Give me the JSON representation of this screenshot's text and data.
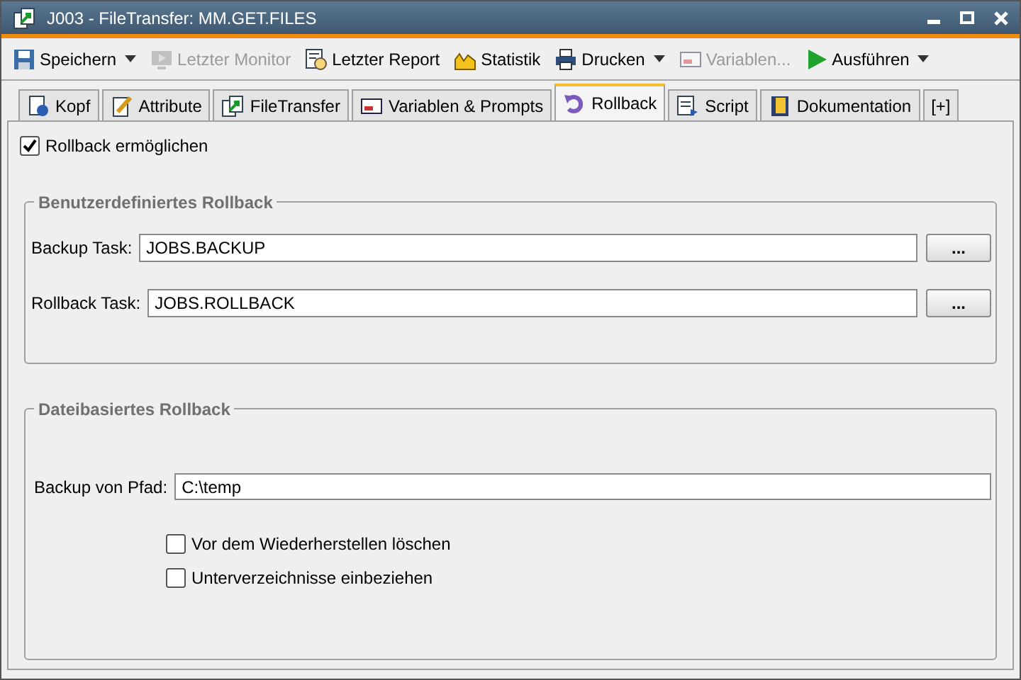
{
  "window": {
    "title": "J003 - FileTransfer: MM.GET.FILES"
  },
  "toolbar": [
    {
      "label": "Speichern",
      "disabled": false,
      "menu": true
    },
    {
      "label": "Letzter Monitor",
      "disabled": true,
      "menu": false
    },
    {
      "label": "Letzter Report",
      "disabled": false,
      "menu": false
    },
    {
      "label": "Statistik",
      "disabled": false,
      "menu": false
    },
    {
      "label": "Drucken",
      "disabled": false,
      "menu": true
    },
    {
      "label": "Variablen...",
      "disabled": true,
      "menu": false
    },
    {
      "label": "Ausführen",
      "disabled": false,
      "menu": true
    }
  ],
  "tabs": [
    {
      "label": "Kopf",
      "selected": false
    },
    {
      "label": "Attribute",
      "selected": false
    },
    {
      "label": "FileTransfer",
      "selected": false
    },
    {
      "label": "Variablen & Prompts",
      "selected": false
    },
    {
      "label": "Rollback",
      "selected": true
    },
    {
      "label": "Script",
      "selected": false
    },
    {
      "label": "Dokumentation",
      "selected": false
    },
    {
      "label": "[+]",
      "selected": false
    }
  ],
  "rollback_enabled": {
    "label": "Rollback ermöglichen",
    "checked": true
  },
  "custom_rollback": {
    "title": "Benutzerdefiniertes Rollback",
    "fields": [
      {
        "label": "Backup Task:",
        "value": "JOBS.BACKUP",
        "button": "..."
      },
      {
        "label": "Rollback Task:",
        "value": "JOBS.ROLLBACK",
        "button": "..."
      }
    ]
  },
  "file_rollback": {
    "title": "Dateibasiertes Rollback",
    "path": {
      "label": "Backup von Pfad:",
      "value": "C:\\temp"
    },
    "options": [
      {
        "label": "Vor dem Wiederherstellen löschen",
        "checked": false
      },
      {
        "label": "Unterverzeichnisse einbeziehen",
        "checked": false
      }
    ]
  }
}
